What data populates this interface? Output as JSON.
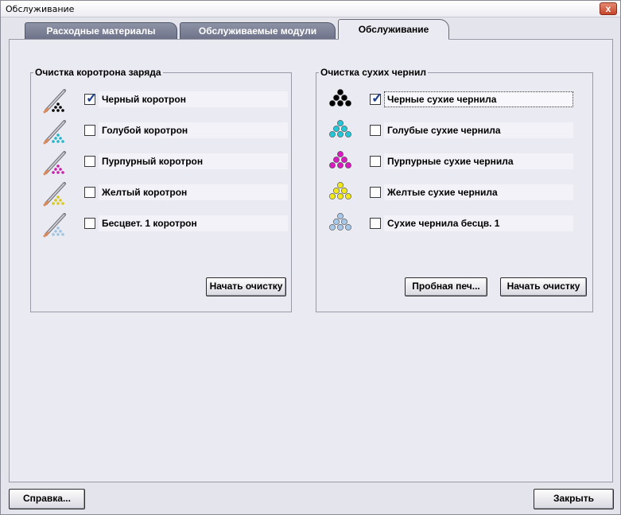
{
  "window": {
    "title": "Обслуживание",
    "close_glyph": "x"
  },
  "tabs": [
    {
      "label": "Расходные материалы",
      "active": false
    },
    {
      "label": "Обслуживаемые модули",
      "active": false
    },
    {
      "label": "Обслуживание",
      "active": true
    }
  ],
  "corotron_group": {
    "title": "Очистка коротрона заряда",
    "items": [
      {
        "label": "Черный коротрон",
        "checked": true,
        "color": "#000000"
      },
      {
        "label": "Голубой коротрон",
        "checked": false,
        "color": "#1fb7c8"
      },
      {
        "label": "Пурпурный коротрон",
        "checked": false,
        "color": "#c81fa8"
      },
      {
        "label": "Желтый коротрон",
        "checked": false,
        "color": "#d8c81a"
      },
      {
        "label": "Бесцвет. 1 коротрон",
        "checked": false,
        "color": "#9ec4e0"
      }
    ],
    "start_button": "Начать очистку"
  },
  "ink_group": {
    "title": "Очистка сухих чернил",
    "items": [
      {
        "label": "Черные сухие чернила",
        "checked": true,
        "color": "#000000"
      },
      {
        "label": "Голубые сухие чернила",
        "checked": false,
        "color": "#22c8d8"
      },
      {
        "label": "Пурпурные сухие чернила",
        "checked": false,
        "color": "#d81ac0"
      },
      {
        "label": "Желтые сухие чернила",
        "checked": false,
        "color": "#f0e81a"
      },
      {
        "label": "Сухие чернила бесцв. 1",
        "checked": false,
        "color": "#a8c8e8"
      }
    ],
    "sample_button": "Пробная печ...",
    "start_button": "Начать очистку"
  },
  "footer": {
    "help_button": "Справка...",
    "close_button": "Закрыть"
  },
  "checkmark_glyph": "✓"
}
